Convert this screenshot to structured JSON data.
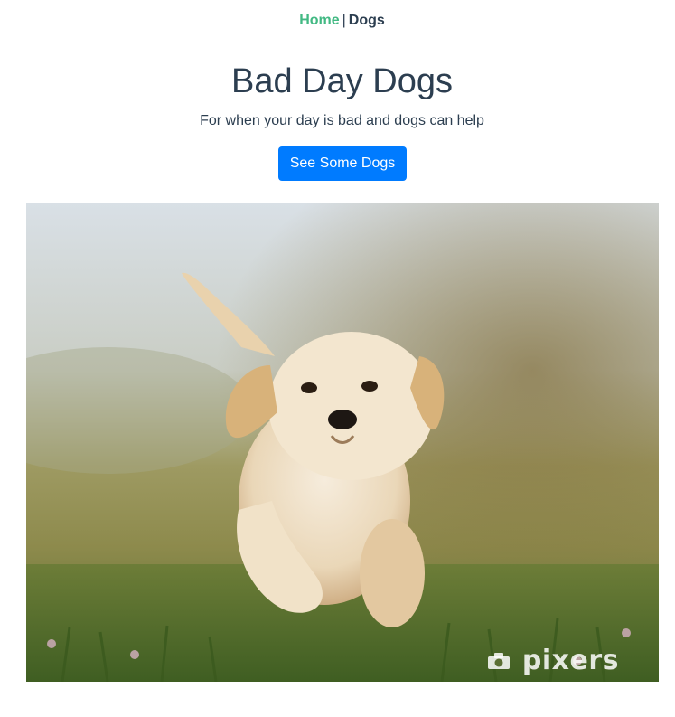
{
  "nav": {
    "home_label": "Home",
    "separator": "|",
    "dogs_label": "Dogs"
  },
  "hero": {
    "title": "Bad Day Dogs",
    "subtitle": "For when your day is bad and dogs can help",
    "button_label": "See Some Dogs"
  },
  "photo": {
    "subject": "puppy running on grass",
    "watermark": "pixers"
  },
  "colors": {
    "text": "#2c3e50",
    "nav_active": "#42b983",
    "button_bg": "#007bff",
    "button_text": "#ffffff"
  }
}
